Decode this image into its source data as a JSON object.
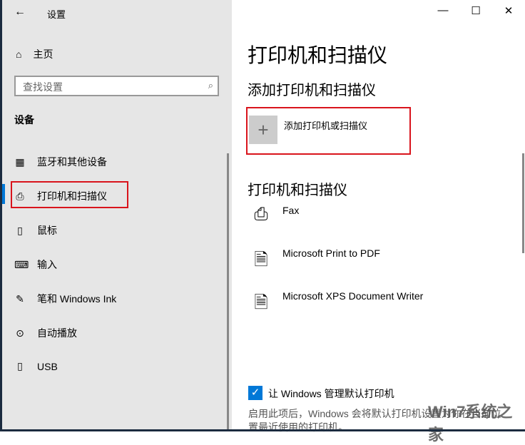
{
  "window": {
    "title": "设置",
    "back": "←",
    "minimize": "—",
    "maximize": "☐",
    "close": "✕"
  },
  "sidebar": {
    "home": "主页",
    "search_placeholder": "查找设置",
    "search_icon": "⌕",
    "category": "设备",
    "items": [
      {
        "label": "蓝牙和其他设备",
        "icon": "▦"
      },
      {
        "label": "打印机和扫描仪",
        "icon": "⎙"
      },
      {
        "label": "鼠标",
        "icon": "▯"
      },
      {
        "label": "输入",
        "icon": "⌨"
      },
      {
        "label": "笔和 Windows Ink",
        "icon": "✎"
      },
      {
        "label": "自动播放",
        "icon": "⊙"
      },
      {
        "label": "USB",
        "icon": "▯"
      }
    ]
  },
  "main": {
    "title": "打印机和扫描仪",
    "add_section": "添加打印机和扫描仪",
    "add_label": "添加打印机或扫描仪",
    "add_icon": "+",
    "list_section": "打印机和扫描仪",
    "devices": [
      {
        "name": "Fax",
        "icon": "⎙"
      },
      {
        "name": "Microsoft Print to PDF",
        "icon": "🗎"
      },
      {
        "name": "Microsoft XPS Document Writer",
        "icon": "🗎"
      }
    ],
    "checkbox_label": "让 Windows 管理默认打印机",
    "checkbox_checked": true,
    "checkbox_mark": "✓",
    "description": "启用此项后，Windows 会将默认打印机设置为你在当前位置最近使用的打印机。"
  },
  "watermark": "Win7系统之家"
}
